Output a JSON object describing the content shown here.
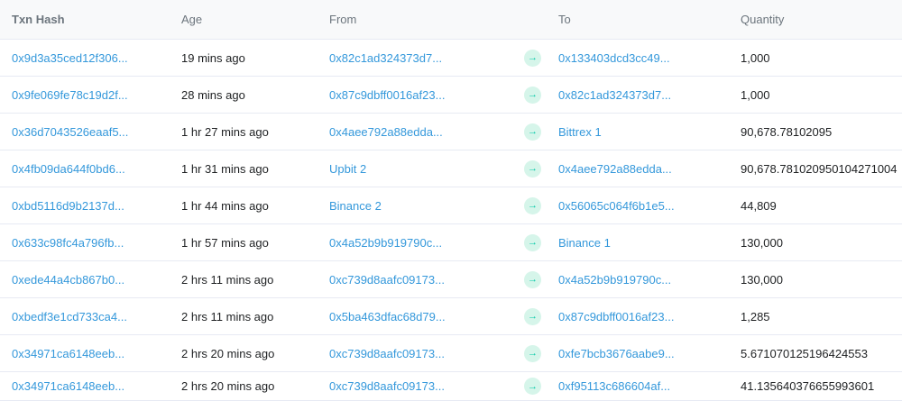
{
  "columns": {
    "hash": "Txn Hash",
    "age": "Age",
    "from": "From",
    "to": "To",
    "quantity": "Quantity"
  },
  "rows": [
    {
      "hash": "0x9d3a35ced12f306...",
      "age": "19 mins ago",
      "from": "0x82c1ad324373d7...",
      "to": "0x133403dcd3cc49...",
      "quantity": "1,000"
    },
    {
      "hash": "0x9fe069fe78c19d2f...",
      "age": "28 mins ago",
      "from": "0x87c9dbff0016af23...",
      "to": "0x82c1ad324373d7...",
      "quantity": "1,000"
    },
    {
      "hash": "0x36d7043526eaaf5...",
      "age": "1 hr 27 mins ago",
      "from": "0x4aee792a88edda...",
      "to": "Bittrex 1",
      "quantity": "90,678.78102095"
    },
    {
      "hash": "0x4fb09da644f0bd6...",
      "age": "1 hr 31 mins ago",
      "from": "Upbit 2",
      "to": "0x4aee792a88edda...",
      "quantity": "90,678.781020950104271004"
    },
    {
      "hash": "0xbd5116d9b2137d...",
      "age": "1 hr 44 mins ago",
      "from": "Binance 2",
      "to": "0x56065c064f6b1e5...",
      "quantity": "44,809"
    },
    {
      "hash": "0x633c98fc4a796fb...",
      "age": "1 hr 57 mins ago",
      "from": "0x4a52b9b919790c...",
      "to": "Binance 1",
      "quantity": "130,000"
    },
    {
      "hash": "0xede44a4cb867b0...",
      "age": "2 hrs 11 mins ago",
      "from": "0xc739d8aafc09173...",
      "to": "0x4a52b9b919790c...",
      "quantity": "130,000"
    },
    {
      "hash": "0xbedf3e1cd733ca4...",
      "age": "2 hrs 11 mins ago",
      "from": "0x5ba463dfac68d79...",
      "to": "0x87c9dbff0016af23...",
      "quantity": "1,285"
    },
    {
      "hash": "0x34971ca6148eeb...",
      "age": "2 hrs 20 mins ago",
      "from": "0xc739d8aafc09173...",
      "to": "0xfe7bcb3676aabe9...",
      "quantity": "5.671070125196424553"
    },
    {
      "hash": "0x34971ca6148eeb...",
      "age": "2 hrs 20 mins ago",
      "from": "0xc739d8aafc09173...",
      "to": "0xf95113c686604af...",
      "quantity": "41.135640376655993601"
    }
  ],
  "arrow_icon": "right-arrow-icon",
  "colors": {
    "link": "#3498db",
    "arrow": "#00c9a7",
    "arrow_bg": "#d6f5ea"
  }
}
